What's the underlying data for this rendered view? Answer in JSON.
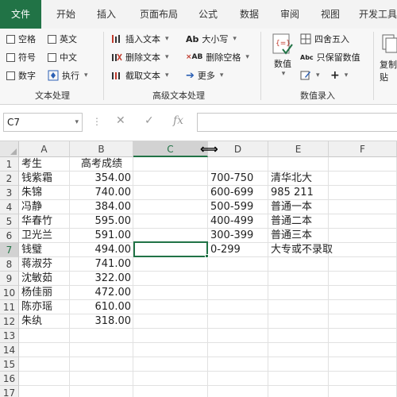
{
  "tabs": [
    {
      "label": "文件",
      "active": true
    },
    {
      "label": "开始"
    },
    {
      "label": "插入"
    },
    {
      "label": "页面布局"
    },
    {
      "label": "公式"
    },
    {
      "label": "数据"
    },
    {
      "label": "审阅"
    },
    {
      "label": "视图"
    },
    {
      "label": "开发工具"
    }
  ],
  "ribbon": {
    "text_processing": {
      "label": "文本处理",
      "items": [
        "空格",
        "英文",
        "符号",
        "中文",
        "数字",
        "执行"
      ]
    },
    "advanced_text": {
      "label": "高级文本处理",
      "items": [
        "插入文本",
        "删除文本",
        "截取文本",
        "大小写",
        "删除空格",
        "更多"
      ]
    },
    "number_entry": {
      "label": "数值录入",
      "items": [
        "数值",
        "四舍五入",
        "只保留数值"
      ],
      "plus": "+"
    },
    "clipboard": {
      "items": [
        "复制",
        "贴"
      ]
    }
  },
  "formula_bar": {
    "name_box": "C7",
    "value": "",
    "icons": [
      "cancel-icon",
      "enter-icon",
      "function-icon"
    ]
  },
  "grid": {
    "columns": [
      "A",
      "B",
      "C",
      "D",
      "E",
      "F"
    ],
    "selected_column": "C",
    "selected_row": "7",
    "rows": [
      "1",
      "2",
      "3",
      "4",
      "5",
      "6",
      "7",
      "8",
      "9",
      "10",
      "11",
      "12",
      "13",
      "14",
      "15",
      "16",
      "17"
    ],
    "colA": [
      "考生",
      "钱紫霜",
      "朱锦",
      "冯静",
      "华春竹",
      "卫光兰",
      "钱璧",
      "蒋淑芬",
      "沈敏茹",
      "杨佳丽",
      "陈亦瑶",
      "朱纨"
    ],
    "colB": [
      "高考成绩",
      "354.00",
      "740.00",
      "384.00",
      "595.00",
      "591.00",
      "494.00",
      "741.00",
      "322.00",
      "472.00",
      "610.00",
      "318.00"
    ],
    "colD": [
      "",
      "700-750",
      "600-699",
      "500-599",
      "400-499",
      "300-399",
      "0-299"
    ],
    "colE": [
      "",
      "清华北大",
      "985 211",
      "普通一本",
      "普通二本",
      "普通三本",
      "大专或不录取"
    ]
  },
  "colors": {
    "accent": "#217346"
  }
}
